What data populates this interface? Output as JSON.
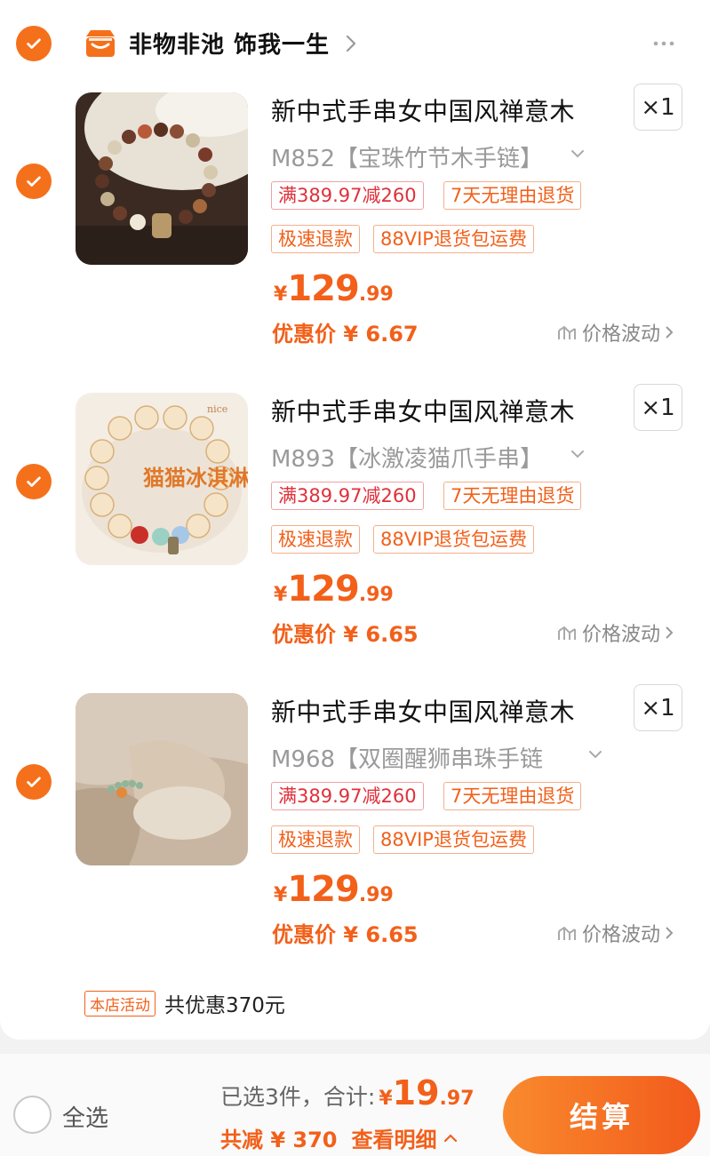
{
  "store": {
    "name": "非物非池 饰我一生",
    "checked": true
  },
  "items": [
    {
      "title": "新中式手串女中国风禅意木",
      "qty": "×1",
      "variant": "M852【宝珠竹节木手链】",
      "tags": [
        "满389.97减260",
        "7天无理由退货",
        "极速退款",
        "88VIP退货包运费"
      ],
      "price_yen": "¥",
      "price_int": "129",
      "price_dec": ".99",
      "discount": "优惠价 ¥ 6.67",
      "fluct": "价格波动",
      "checked": true
    },
    {
      "title": "新中式手串女中国风禅意木",
      "qty": "×1",
      "variant": "M893【冰激凌猫爪手串】",
      "tags": [
        "满389.97减260",
        "7天无理由退货",
        "极速退款",
        "88VIP退货包运费"
      ],
      "price_yen": "¥",
      "price_int": "129",
      "price_dec": ".99",
      "discount": "优惠价 ¥ 6.65",
      "fluct": "价格波动",
      "image_text": "猫猫冰淇淋",
      "image_badge": "nice",
      "checked": true
    },
    {
      "title": "新中式手串女中国风禅意木",
      "qty": "×1",
      "variant": "M968【双圈醒狮串珠手链",
      "tags": [
        "满389.97减260",
        "7天无理由退货",
        "极速退款",
        "88VIP退货包运费"
      ],
      "price_yen": "¥",
      "price_int": "129",
      "price_dec": ".99",
      "discount": "优惠价 ¥ 6.65",
      "fluct": "价格波动",
      "checked": true
    }
  ],
  "promo": {
    "badge": "本店活动",
    "text": "共优惠370元"
  },
  "footer": {
    "select_all": "全选",
    "selected_label": "已选3件，合计:",
    "total_yen": "¥",
    "total_int": "19",
    "total_dec": ".97",
    "saved": "共减 ¥ 370",
    "detail": "查看明细",
    "checkout": "结算"
  },
  "colors": {
    "accent": "#f5701a",
    "price": "#f2601a",
    "tag_red": "#e0303a"
  }
}
